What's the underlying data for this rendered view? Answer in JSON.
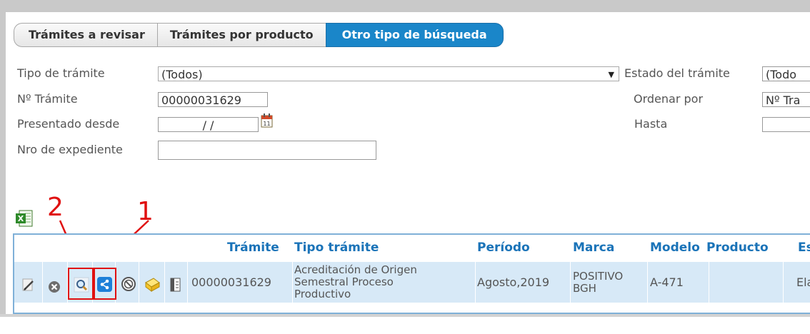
{
  "tabs": [
    {
      "label": "Trámites a revisar"
    },
    {
      "label": "Trámites por producto"
    },
    {
      "label": "Otro tipo de búsqueda"
    }
  ],
  "form": {
    "tipo_label": "Tipo de trámite",
    "tipo_value": "(Todos)",
    "estado_label": "Estado del trámite",
    "estado_value": "(Todo",
    "nro_label": "Nº Trámite",
    "nro_value": "00000031629",
    "ordenar_label": "Ordenar por",
    "ordenar_value": "Nº Tra",
    "desde_label": "Presentado desde",
    "desde_value": "/ /",
    "hasta_label": "Hasta",
    "expediente_label": "Nro de expediente"
  },
  "annotations": {
    "left": "2",
    "right": "1"
  },
  "table": {
    "headers": [
      "Trámite",
      "Tipo trámite",
      "Período",
      "Marca",
      "Modelo",
      "Producto",
      "Es"
    ],
    "row": {
      "tramite": "00000031629",
      "tipo_line1": "Acreditación de Origen",
      "tipo_line2": "Semestral Proceso",
      "tipo_line3": "Productivo",
      "periodo": "Agosto,2019",
      "marca_line1": "POSITIVO",
      "marca_line2": "BGH",
      "modelo": "A-471",
      "estado": "Ela"
    }
  },
  "colors": {
    "accent": "#1a86c9",
    "header_text": "#1a73b8",
    "row_bg": "#d7e9f7",
    "annotation": "#e01010"
  }
}
